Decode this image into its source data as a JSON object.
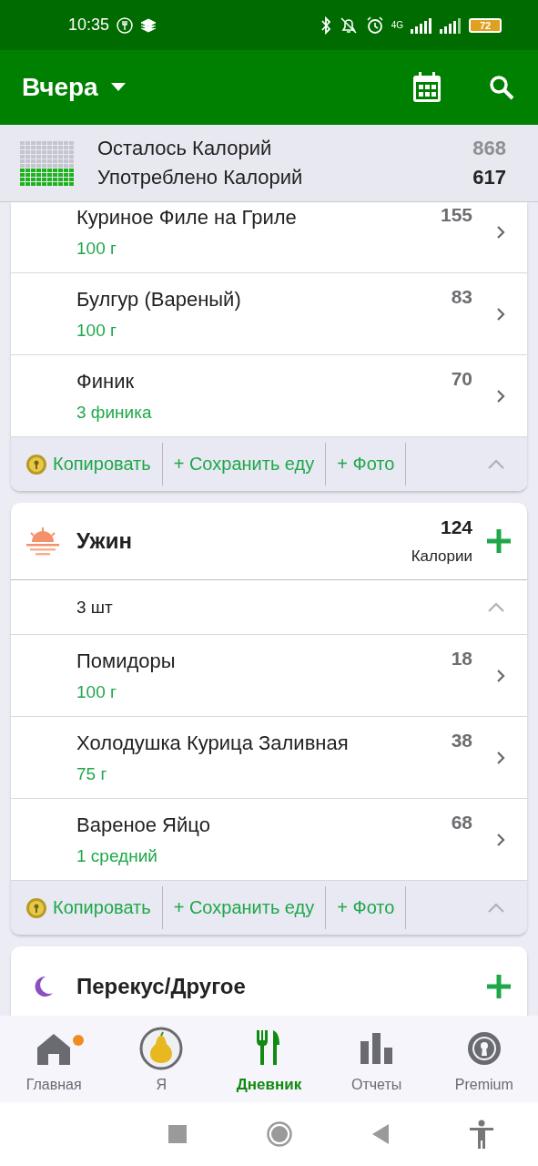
{
  "status_bar": {
    "time": "10:35",
    "network": "4G",
    "battery": "72"
  },
  "app_bar": {
    "title": "Вчера"
  },
  "summary": {
    "rows": [
      {
        "label": "Осталось Калорий",
        "value": "868",
        "kind": "remaining"
      },
      {
        "label": "Употреблено Калорий",
        "value": "617",
        "kind": "eaten"
      }
    ]
  },
  "meals": [
    {
      "kind": "continued",
      "items": [
        {
          "name": "Куриное Филе на Гриле",
          "amount": "100 г",
          "calories": "155"
        },
        {
          "name": "Булгур (Вареный)",
          "amount": "100 г",
          "calories": "83"
        },
        {
          "name": "Финик",
          "amount": "3 финика",
          "calories": "70"
        }
      ],
      "actions": [
        "Копировать",
        "+ Сохранить еду",
        "+ Фото"
      ]
    },
    {
      "kind": "dinner",
      "title": "Ужин",
      "calories": "124",
      "calories_label": "Калории",
      "count": "3 шт",
      "expanded": true,
      "items": [
        {
          "name": "Помидоры",
          "amount": "100 г",
          "calories": "18"
        },
        {
          "name": "Холодушка Курица Заливная",
          "amount": "75 г",
          "calories": "38"
        },
        {
          "name": "Вареное Яйцо",
          "amount": "1 средний",
          "calories": "68"
        }
      ],
      "actions": [
        "Копировать",
        "+ Сохранить еду",
        "+ Фото"
      ]
    },
    {
      "kind": "snack",
      "title": "Перекус/Другое"
    }
  ],
  "bottom_nav": [
    {
      "label": "Главная",
      "kind": "home",
      "selected": false,
      "badge": true
    },
    {
      "label": "Я",
      "kind": "profile",
      "selected": false,
      "badge": false
    },
    {
      "label": "Дневник",
      "kind": "diary",
      "selected": true,
      "badge": false
    },
    {
      "label": "Отчеты",
      "kind": "reports",
      "selected": false,
      "badge": false
    },
    {
      "label": "Premium",
      "kind": "premium",
      "selected": false,
      "badge": false
    }
  ]
}
